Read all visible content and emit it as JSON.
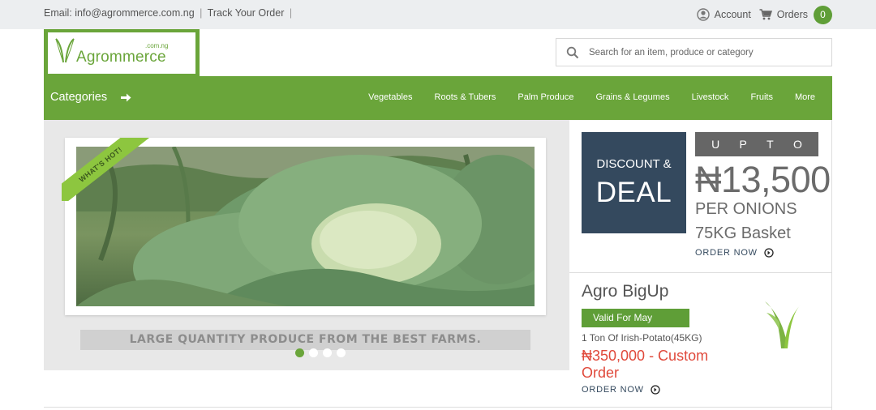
{
  "topbar": {
    "email": "Email: info@agrommerce.com.ng",
    "track": "Track Your Order",
    "sep1": "|",
    "sep2": "|",
    "account": "Account",
    "orders": "Orders",
    "orders_count": "0"
  },
  "logo": {
    "name": "Agrommerce",
    "suffix": ".com.ng"
  },
  "search": {
    "placeholder": "Search for an item, produce or category"
  },
  "nav": {
    "categories_label": "Categories",
    "links": [
      "Vegetables",
      "Roots & Tubers",
      "Palm Produce",
      "Grains & Legumes",
      "Livestock",
      "Fruits",
      "More"
    ]
  },
  "hero": {
    "ribbon": "WHAT'S HOT!",
    "caption": "LARGE QUANTITY PRODUCE FROM THE BEST FARMS.",
    "slide_count": 4,
    "active_slide": 1
  },
  "deal": {
    "line1": "DISCOUNT &",
    "line2": "DEAL",
    "upto": [
      "U",
      "P",
      "T",
      "O"
    ],
    "price": "₦13,500",
    "per": "PER ONIONS",
    "basket": "75KG Basket",
    "order_now": "ORDER NOW"
  },
  "bigup": {
    "title": "Agro BigUp",
    "badge": "Valid For May",
    "product": "1 Ton Of Irish-Potato(45KG)",
    "price": "₦350,000 - Custom Order",
    "order_now": "ORDER NOW"
  },
  "colors": {
    "brand_green": "#6aa53a",
    "navy": "#34495e",
    "price_red": "#e0493b"
  },
  "icons": {
    "account": "user-circle-icon",
    "orders": "cart-icon",
    "search": "search-icon",
    "categories": "arrow-right-icon",
    "order_now": "circle-arrow-icon"
  }
}
